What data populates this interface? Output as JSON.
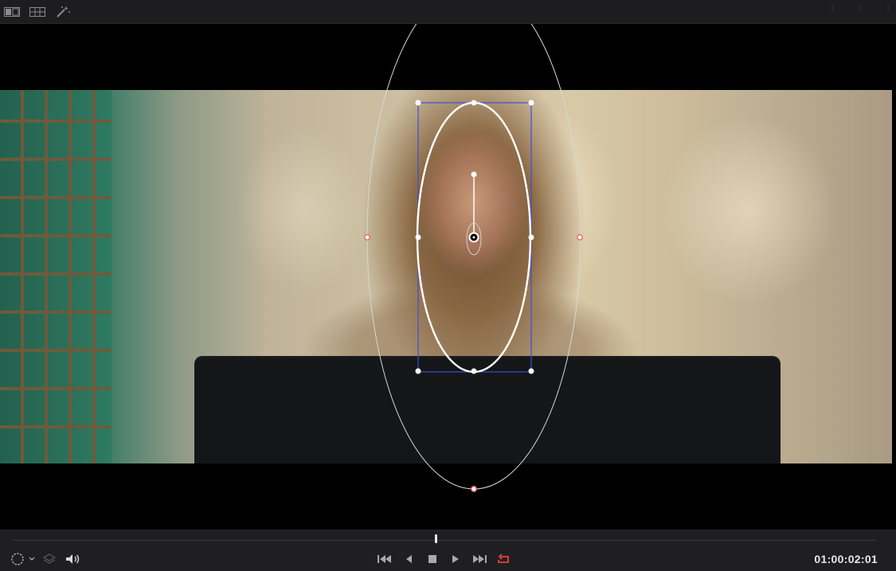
{
  "toolbar": {
    "icons": [
      "viewer-layout-icon",
      "grid-icon",
      "magic-wand-icon"
    ]
  },
  "viewer": {
    "window_tools": [
      "circle-window"
    ]
  },
  "transport": {
    "timecode": "01:00:02:01",
    "playhead_position": 0.49,
    "controls": [
      "jump-to-start",
      "step-back",
      "stop",
      "play",
      "jump-to-end",
      "loop"
    ],
    "loop_active": true,
    "colors": {
      "loop_active": "#e8423a",
      "window_outline": "#ffffff",
      "bounding_box": "#3d4fd6",
      "softness_handle": "#e86a6a"
    }
  }
}
